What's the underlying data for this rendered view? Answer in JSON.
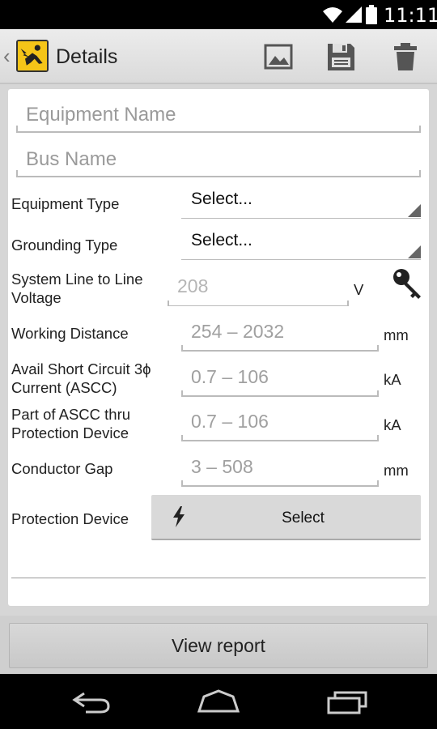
{
  "status_bar": {
    "time": "11:11"
  },
  "action_bar": {
    "back_chevron": "‹",
    "title": "Details",
    "icons": [
      "image-icon",
      "save-icon",
      "delete-icon"
    ]
  },
  "form": {
    "equipment_name_placeholder": "Equipment Name",
    "bus_name_placeholder": "Bus Name",
    "equipment_type": {
      "label": "Equipment Type",
      "value": "Select..."
    },
    "grounding_type": {
      "label": "Grounding Type",
      "value": "Select..."
    },
    "system_voltage": {
      "label_line1": "System Line to Line",
      "label_line2": "Voltage",
      "placeholder": "208",
      "unit": "V"
    },
    "working_distance": {
      "label": "Working Distance",
      "placeholder": "254 – 2032",
      "unit": "mm"
    },
    "ascc": {
      "label_line1": "Avail Short Circuit 3ϕ",
      "label_line2": "Current (ASCC)",
      "placeholder": "0.7 – 106",
      "unit": "kA"
    },
    "ascc_thru_device": {
      "label_line1": "Part of ASCC thru",
      "label_line2": "Protection Device",
      "placeholder": "0.7 – 106",
      "unit": "kA"
    },
    "conductor_gap": {
      "label": "Conductor Gap",
      "placeholder": "3 – 508",
      "unit": "mm"
    },
    "protection_device": {
      "label": "Protection Device",
      "button_label": "Select"
    }
  },
  "footer": {
    "view_report_label": "View report"
  },
  "colors": {
    "accent": "#f5c518",
    "card": "#ffffff",
    "background": "#d6d6d6"
  }
}
